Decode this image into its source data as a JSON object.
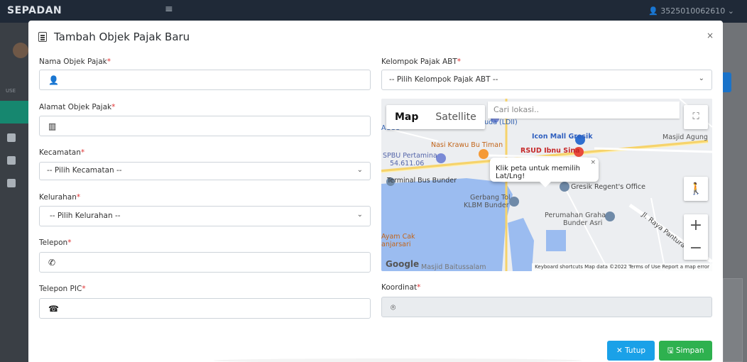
{
  "app": {
    "brand": "SEPADAN",
    "user": "352501006261​0"
  },
  "sidebar": {
    "section_label": "USE"
  },
  "modal": {
    "title": "Tambah Objek Pajak Baru",
    "close": "×",
    "fields": {
      "nama_label": "Nama Objek Pajak",
      "alamat_label": "Alamat Objek Pajak",
      "kecamatan_label": "Kecamatan",
      "kecamatan_placeholder": "-- Pilih Kecamatan --",
      "kelurahan_label": "Kelurahan",
      "kelurahan_placeholder": "-- Pilih Kelurahan --",
      "telepon_label": "Telepon",
      "telepon_pic_label": "Telepon PIC",
      "kelompok_label": "Kelompok Pajak ABT",
      "kelompok_placeholder": "-- Pilih Kelompok Pajak ABT --",
      "koordinat_label": "Koordinat",
      "required_mark": "*"
    },
    "map": {
      "type_map": "Map",
      "type_satellite": "Satellite",
      "search_placeholder": "Cari lokasi..",
      "tooltip": "Klik peta untuk memilih Lat/Lng!",
      "google": "Google",
      "footer": "Keyboard shortcuts   Map data ©2022   Terms of Use   Report a map error",
      "labels": [
        "ACCU",
        "Huda (LDII)",
        "Icon Mall Gresik",
        "Masjid Agung",
        "Nasi Krawu Bu Timan",
        "RSUD Ibnu Sina",
        "SPBU Pertamina",
        "54.611.06",
        "Terminal Bus Bunder",
        "Gresik Regent's Office",
        "Gerbang Tol",
        "KLBM Bunder",
        "Perumahan Graha",
        "Bunder Asri",
        "Jl. Raya Pantura",
        "Ayam Cak",
        "anjarsari",
        "Masjid Baitussalam"
      ]
    },
    "buttons": {
      "tutup": "Tutup",
      "simpan": "Simpan"
    }
  }
}
